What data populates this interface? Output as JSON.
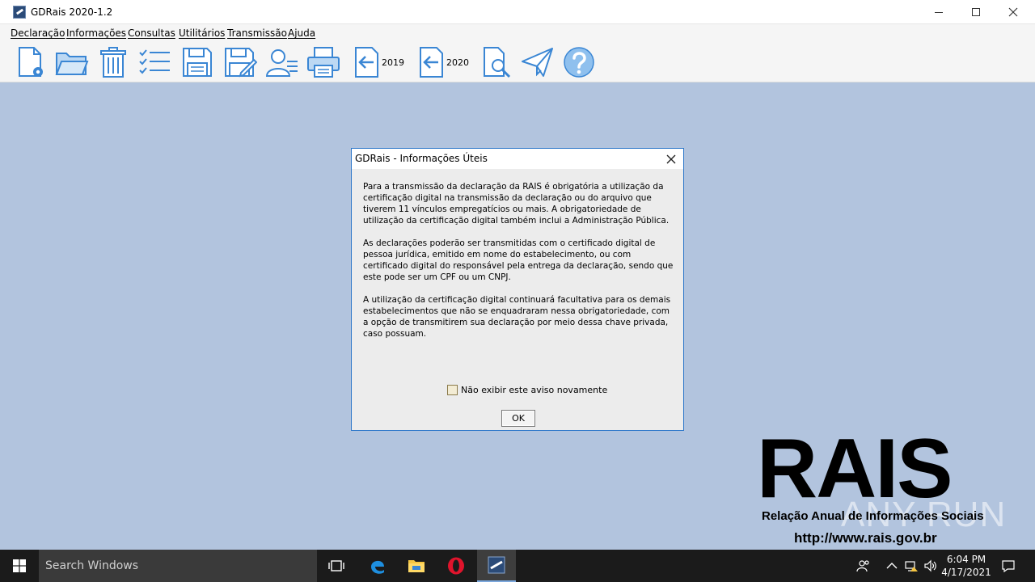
{
  "window": {
    "title": "GDRais 2020-1.2"
  },
  "menu": [
    {
      "label": "Declaração"
    },
    {
      "label": "Informações"
    },
    {
      "label": "Consultas"
    },
    {
      "label": "Utilitários"
    },
    {
      "label": "Transmissão"
    },
    {
      "label": "Ajuda"
    }
  ],
  "toolbar": {
    "year_prev_label": "2019",
    "year_curr_label": "2020"
  },
  "dialog": {
    "title": "GDRais - Informações Úteis",
    "paragraphs": [
      "Para a transmissão da declaração da RAIS é obrigatória a utilização da certificação digital na transmissão da declaração ou do arquivo que tiverem 11 vínculos empregatícios ou mais. A obrigatoriedade de utilização da certificação digital também inclui a Administração Pública.",
      "As declarações poderão ser transmitidas com o certificado digital de pessoa jurídica, emitido em nome do estabelecimento, ou com certificado digital do responsável pela entrega da declaração, sendo que este pode ser um CPF ou um CNPJ.",
      "A utilização da certificação digital continuará facultativa para os demais estabelecimentos que não se enquadraram nessa obrigatoriedade, com a opção de transmitirem sua declaração por meio dessa chave privada, caso possuam."
    ],
    "checkbox_label": "Não exibir este aviso novamente",
    "ok_label": "OK"
  },
  "logo": {
    "big": "RAIS",
    "subtitle": "Relação Anual de Informações Sociais",
    "url": "http://www.rais.gov.br"
  },
  "watermark": "ANY RUN",
  "taskbar": {
    "search_placeholder": "Search Windows",
    "time": "6:04 PM",
    "date": "4/17/2021"
  },
  "colors": {
    "desktop_bg": "#b2c4de",
    "icon_blue": "#4a90d9",
    "dialog_border": "#2b76c9"
  }
}
